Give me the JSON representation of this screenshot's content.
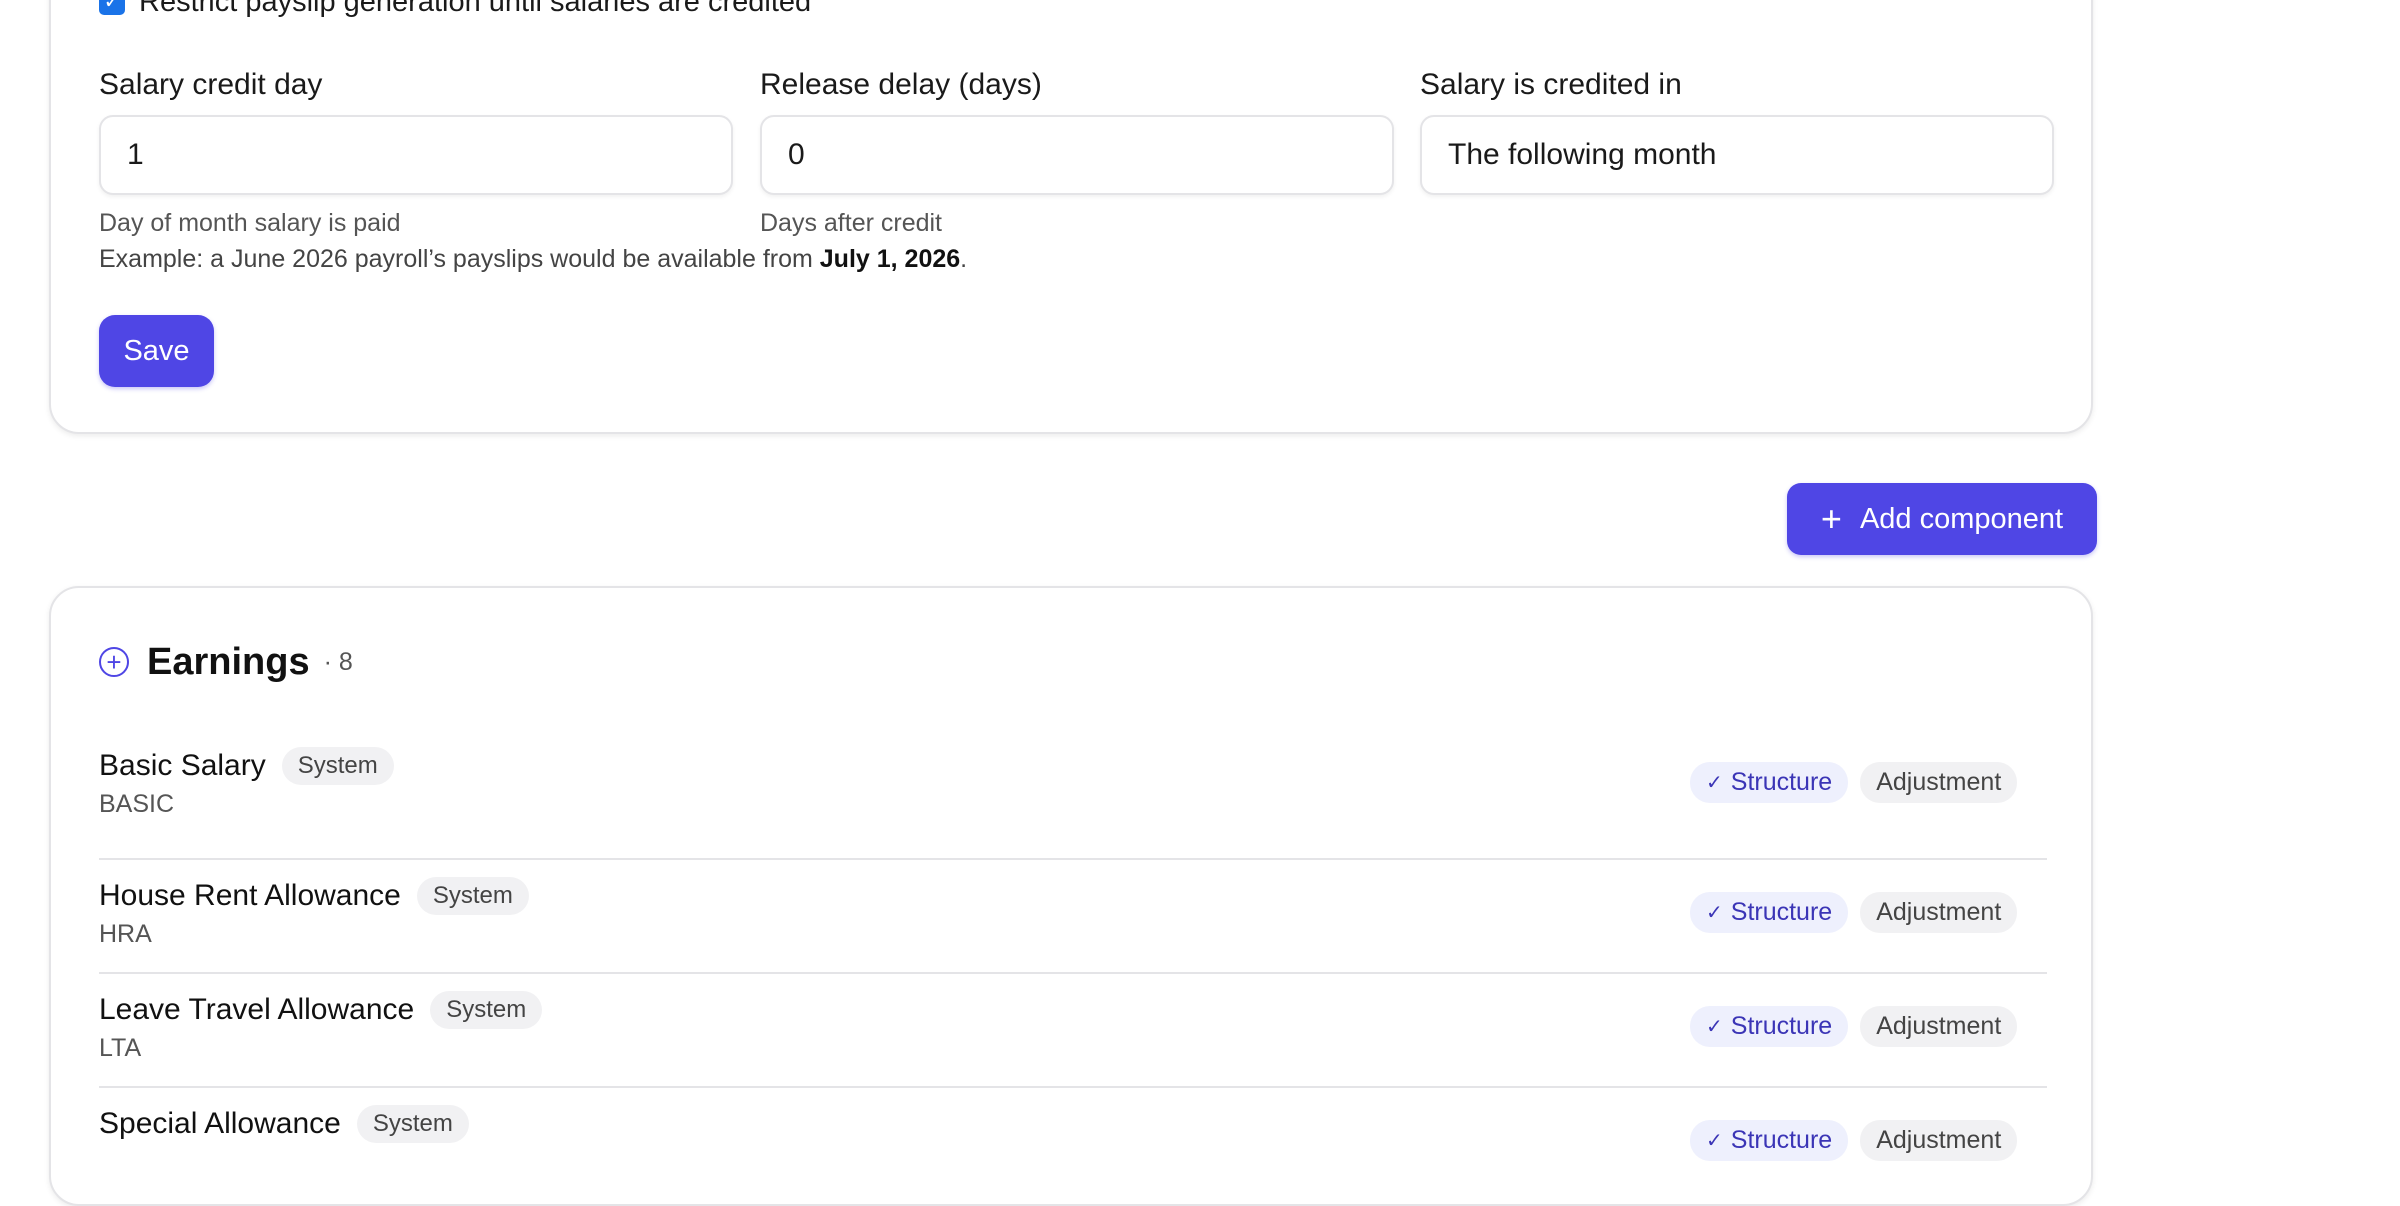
{
  "payslip_settings": {
    "restrict_label": "Restrict payslip generation until salaries are credited",
    "restrict_checked": true,
    "fields": [
      {
        "label": "Salary credit day",
        "value": "1",
        "hint": "Day of month salary is paid"
      },
      {
        "label": "Release delay (days)",
        "value": "0",
        "hint": "Days after credit"
      },
      {
        "label": "Salary is credited in",
        "value": "The following month",
        "hint": ""
      }
    ],
    "example_prefix": "Example: a June 2026 payroll’s payslips would be available from ",
    "example_date": "July 1, 2026",
    "example_suffix": ".",
    "save_label": "Save"
  },
  "toolbar": {
    "add_icon": "+",
    "add_label": "Add component"
  },
  "earnings": {
    "icon": "⊕",
    "title": "Earnings",
    "count": "· 8",
    "rows": [
      {
        "name": "Basic Salary",
        "badge": "System",
        "code": "BASIC",
        "structure": "Structure",
        "adjustment": "Adjustment"
      },
      {
        "name": "House Rent Allowance",
        "badge": "System",
        "code": "HRA",
        "structure": "Structure",
        "adjustment": "Adjustment"
      },
      {
        "name": "Leave Travel Allowance",
        "badge": "System",
        "code": "LTA",
        "structure": "Structure",
        "adjustment": "Adjustment"
      },
      {
        "name": "Special Allowance",
        "badge": "System",
        "code": "",
        "structure": "Structure",
        "adjustment": "Adjustment"
      }
    ]
  },
  "colors": {
    "accent": "#4f46e5",
    "structure_tag_bg": "#eef0fd",
    "structure_tag_text": "#3b35b6",
    "neutral_tag_bg": "#f1f1f3",
    "border": "#e4e4e7"
  }
}
